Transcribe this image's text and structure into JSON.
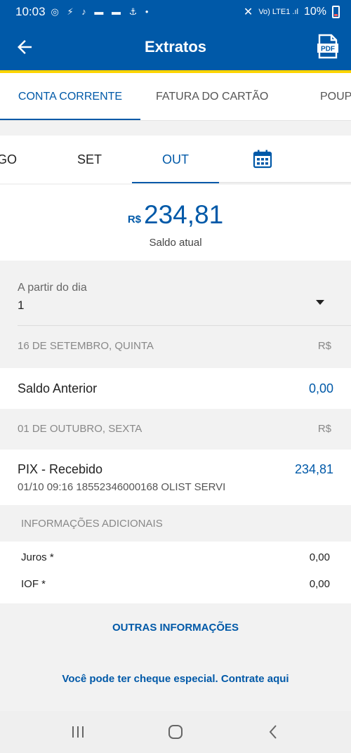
{
  "status_bar": {
    "time": "10:03",
    "left_icons": "◎ ⚡ ♪ ▬ ▬ ⚓ •",
    "network": "Vo) LTE1 .ıl",
    "battery": "10%"
  },
  "app_bar": {
    "title": "Extratos",
    "pdf_label": "PDF"
  },
  "tabs": [
    {
      "label": "CONTA CORRENTE",
      "active": true
    },
    {
      "label": "FATURA DO CARTÃO",
      "active": false
    },
    {
      "label": "POUPA",
      "active": false
    }
  ],
  "months": [
    {
      "label": "GO",
      "active": false
    },
    {
      "label": "SET",
      "active": false
    },
    {
      "label": "OUT",
      "active": true
    }
  ],
  "balance": {
    "currency": "R$",
    "value": "234,81",
    "label": "Saldo atual"
  },
  "day_picker": {
    "label": "A partir do dia",
    "value": "1"
  },
  "sections": [
    {
      "date": "16 DE SETEMBRO, QUINTA",
      "currency": "R$",
      "entry": {
        "title": "Saldo Anterior",
        "amount": "0,00"
      }
    },
    {
      "date": "01 DE OUTUBRO, SEXTA",
      "currency": "R$",
      "entry": {
        "title": "PIX - Recebido",
        "amount": "234,81",
        "detail": "01/10 09:16 18552346000168 OLIST SERVI"
      }
    }
  ],
  "additional_info": {
    "header": "INFORMAÇÕES ADICIONAIS",
    "items": [
      {
        "label": "Juros *",
        "value": "0,00"
      },
      {
        "label": "IOF *",
        "value": "0,00"
      }
    ]
  },
  "links": {
    "more_info": "OUTRAS INFORMAÇÕES",
    "overdraft": "Você pode ter cheque especial. Contrate aqui"
  },
  "colors": {
    "primary": "#0059a8",
    "accent": "#ffd400",
    "background": "#f2f2f2"
  }
}
